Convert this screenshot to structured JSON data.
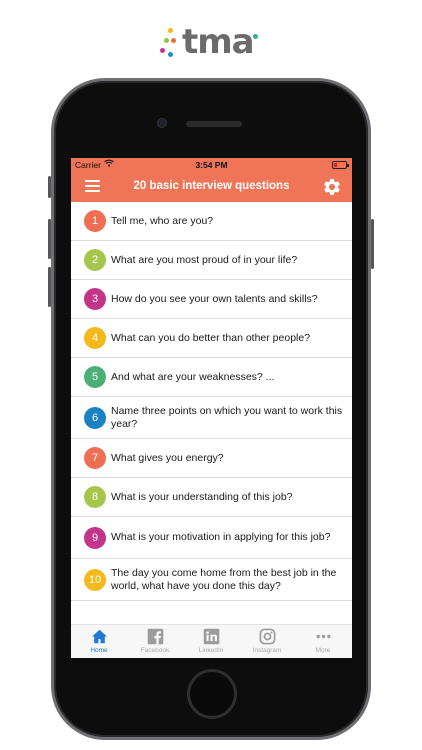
{
  "brand": {
    "logo_text": "tma",
    "colors": [
      "#f06b3f",
      "#8cc63f",
      "#1a8ed1",
      "#f4b81d",
      "#c2358a",
      "#2eb39a"
    ]
  },
  "statusbar": {
    "carrier": "Carrier",
    "time": "3:54 PM"
  },
  "navbar": {
    "title": "20 basic interview questions",
    "accent": "#f07458"
  },
  "questions": [
    {
      "number": "1",
      "text": "Tell me, who are you?",
      "color": "#ee6f53"
    },
    {
      "number": "2",
      "text": "What are you most proud of in your life?",
      "color": "#a6c54a"
    },
    {
      "number": "3",
      "text": "How do you see your own talents and skills?",
      "color": "#c2358a"
    },
    {
      "number": "4",
      "text": "What can you do better than other people?",
      "color": "#f4b81d"
    },
    {
      "number": "5",
      "text": "And what are your weaknesses? ...",
      "color": "#4caf76"
    },
    {
      "number": "6",
      "text": "Name three points on which you want to work this year?",
      "color": "#1a82c4"
    },
    {
      "number": "7",
      "text": "What gives you energy?",
      "color": "#ee6f53"
    },
    {
      "number": "8",
      "text": "What is your understanding of this job?",
      "color": "#a6c54a"
    },
    {
      "number": "9",
      "text": "What is your motivation in applying for this job?",
      "color": "#c2358a"
    },
    {
      "number": "10",
      "text": "The day you come home from the best job in the world, what have you done this day?",
      "color": "#f4b81d"
    }
  ],
  "tabbar": {
    "items": [
      {
        "label": "Home",
        "icon": "home-icon",
        "active": true
      },
      {
        "label": "Facebook",
        "icon": "facebook-icon",
        "active": false
      },
      {
        "label": "LinkedIn",
        "icon": "linkedin-icon",
        "active": false
      },
      {
        "label": "Instagram",
        "icon": "instagram-icon",
        "active": false
      },
      {
        "label": "More",
        "icon": "more-icon",
        "active": false
      }
    ]
  }
}
